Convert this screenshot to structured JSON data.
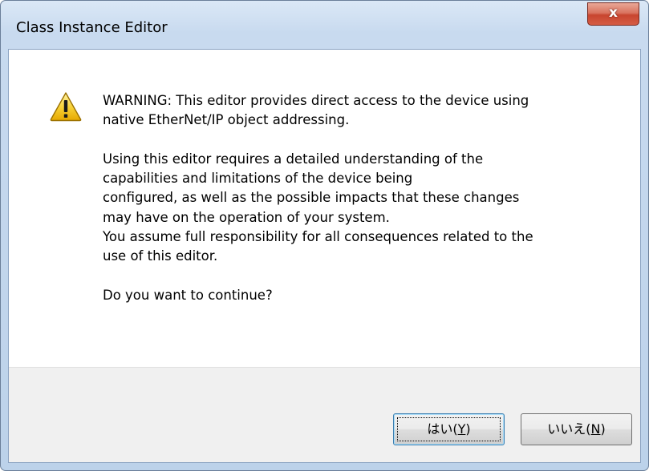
{
  "window": {
    "title": "Class Instance Editor",
    "close_glyph": "x"
  },
  "message": {
    "line1": "WARNING: This editor provides direct access to the device using",
    "line2": "native EtherNet/IP object addressing.",
    "line3": "Using this editor requires a detailed understanding of the",
    "line4": "capabilities and limitations of the device being",
    "line5": "configured, as well as the possible impacts that these changes",
    "line6": "may have on the operation of your system.",
    "line7": "You assume full responsibility for all consequences related to the",
    "line8": "use of this editor.",
    "line9": "Do you want to continue?"
  },
  "icon": "warning-icon",
  "buttons": {
    "yes_prefix": "はい(",
    "yes_key": "Y",
    "yes_suffix": ")",
    "no_prefix": "いいえ(",
    "no_key": "N",
    "no_suffix": ")"
  },
  "colors": {
    "titlebar": "#c8daef",
    "close_button": "#c8452f",
    "warning_yellow": "#f5c400",
    "footer": "#f0f0f0"
  }
}
